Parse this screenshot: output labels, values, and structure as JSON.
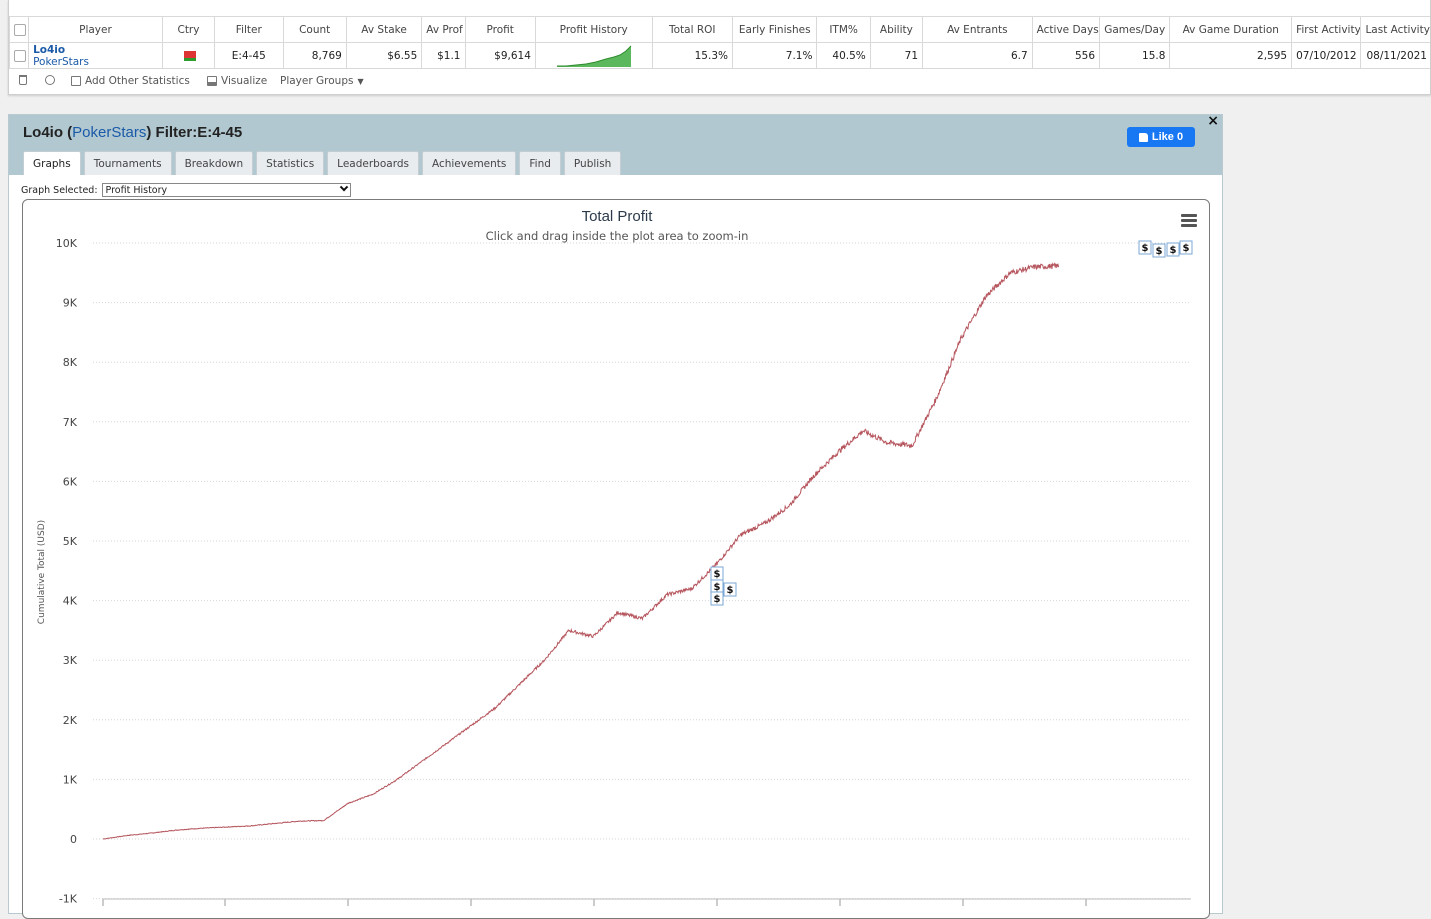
{
  "stats_table": {
    "headers": [
      "Player",
      "Ctry",
      "Filter",
      "Count",
      "Av Stake",
      "Av Prof",
      "Profit",
      "Profit History",
      "Total ROI",
      "Early Finishes",
      "ITM%",
      "Ability",
      "Av Entrants",
      "Active Days",
      "Games/Day",
      "Av Game Duration",
      "First Activity",
      "Last Activity"
    ],
    "row": {
      "player_name": "Lo4io",
      "site": "PokerStars",
      "filter": "E:4-45",
      "count": "8,769",
      "av_stake": "$6.55",
      "av_prof": "$1.1",
      "profit": "$9,614",
      "total_roi": "15.3%",
      "early_finishes": "7.1%",
      "itm": "40.5%",
      "ability": "71",
      "av_entrants": "6.7",
      "active_days": "556",
      "games_per_day": "15.8",
      "av_game_duration": "2,595",
      "first_activity": "07/10/2012",
      "last_activity": "08/11/2021"
    },
    "toolbar": {
      "add_stats": "Add Other Statistics",
      "visualize": "Visualize",
      "player_groups": "Player Groups"
    }
  },
  "panel": {
    "player_name": "Lo4io",
    "site": "PokerStars",
    "filter_label": "Filter:E:4-45",
    "fb_like": "Like 0",
    "close": "×",
    "tabs": [
      "Graphs",
      "Tournaments",
      "Breakdown",
      "Statistics",
      "Leaderboards",
      "Achievements",
      "Find",
      "Publish"
    ],
    "graph_selected_label": "Graph Selected:",
    "graph_selected_value": "Profit History"
  },
  "chart_data": {
    "type": "line",
    "title": "Total Profit",
    "subtitle": "Click and drag inside the plot area to zoom-in",
    "ylabel": "Cumulative Total (USD)",
    "ylim": [
      -1000,
      10000
    ],
    "yticks": [
      "-1K",
      "0",
      "1K",
      "2K",
      "3K",
      "4K",
      "5K",
      "6K",
      "7K",
      "8K",
      "9K",
      "10K"
    ],
    "ytick_values": [
      -1000,
      0,
      1000,
      2000,
      3000,
      4000,
      5000,
      6000,
      7000,
      8000,
      9000,
      10000
    ],
    "grid": true,
    "line_color": "#b5545c",
    "markers_label": "$",
    "series": [
      {
        "x": [
          0,
          200,
          400,
          600,
          800,
          1000,
          1200,
          1400,
          1600,
          1800,
          2000,
          2200,
          2400,
          2600,
          2800,
          3000,
          3200,
          3400,
          3600,
          3800,
          4000,
          4200,
          4400,
          4600,
          4800,
          5000,
          5200,
          5400,
          5600,
          5800,
          6000,
          6200,
          6400,
          6600,
          6800,
          7000,
          7200,
          7400,
          7600,
          7800,
          8000,
          8200,
          8400,
          8600,
          8769
        ],
        "values": [
          0,
          60,
          100,
          150,
          180,
          200,
          220,
          260,
          300,
          310,
          600,
          750,
          1000,
          1300,
          1600,
          1900,
          2200,
          2600,
          3000,
          3500,
          3400,
          3800,
          3700,
          4100,
          4200,
          4600,
          5100,
          5300,
          5600,
          6100,
          6500,
          6850,
          6650,
          6600,
          7400,
          8400,
          9100,
          9500,
          9600,
          9614,
          9614,
          9614,
          9614,
          9614,
          9614
        ]
      }
    ]
  }
}
